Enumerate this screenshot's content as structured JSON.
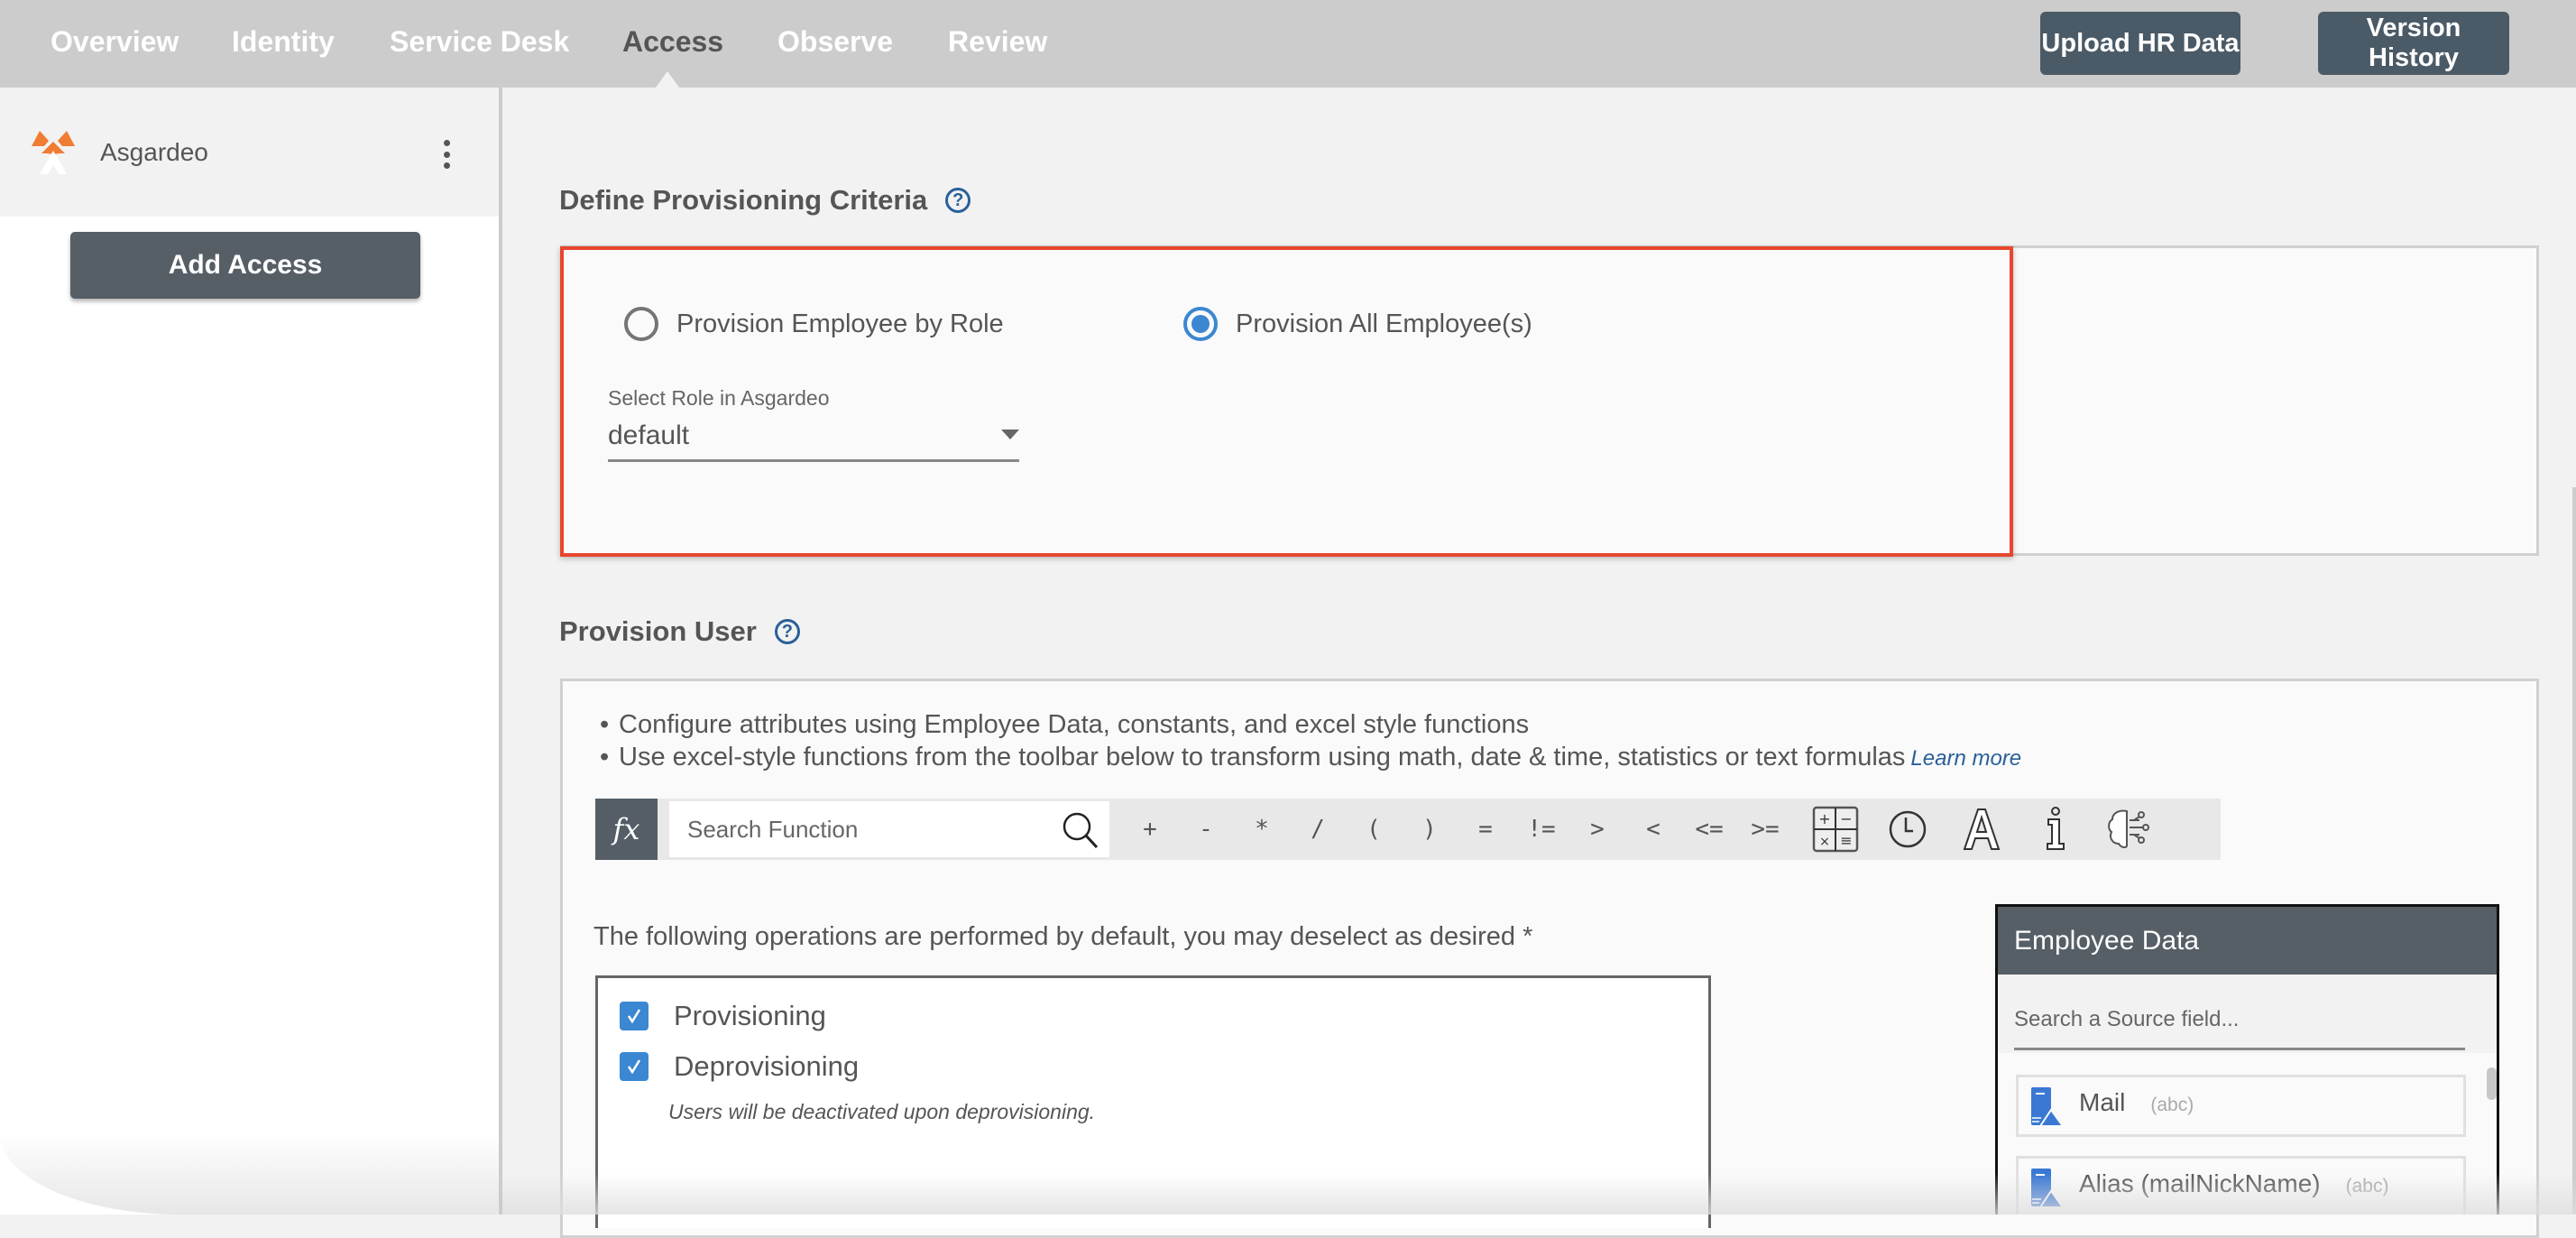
{
  "nav": {
    "tabs": [
      {
        "label": "Overview",
        "active": false
      },
      {
        "label": "Identity",
        "active": false
      },
      {
        "label": "Service Desk",
        "active": false
      },
      {
        "label": "Access",
        "active": true
      },
      {
        "label": "Observe",
        "active": false
      },
      {
        "label": "Review",
        "active": false
      }
    ],
    "upload_label": "Upload HR Data",
    "version_label": "Version History"
  },
  "sidebar": {
    "app_name": "Asgardeo",
    "app_logo": "asgardeo-logo",
    "menu_icon": "kebab-menu-icon",
    "add_access_label": "Add Access"
  },
  "criteria": {
    "title": "Define Provisioning Criteria",
    "help_glyph": "?",
    "options": [
      {
        "label": "Provision Employee by Role",
        "selected": false
      },
      {
        "label": "Provision All Employee(s)",
        "selected": true
      }
    ],
    "role_select": {
      "label": "Select Role in Asgardeo",
      "value": "default"
    },
    "highlight_color": "#e8462e"
  },
  "provision_user": {
    "title": "Provision User",
    "help_glyph": "?",
    "bullets": [
      "Configure attributes using Employee Data, constants, and excel style functions",
      "Use excel-style functions from the toolbar below to transform using math, date & time, statistics or text formulas"
    ],
    "learn_more": "Learn more",
    "toolbar": {
      "fx_label": "fx",
      "search_placeholder": "Search Function",
      "operators": [
        "+",
        "-",
        "*",
        "/",
        "(",
        ")",
        "=",
        "!=",
        ">",
        "<",
        "<=",
        ">="
      ],
      "tools": [
        "math-calculator-icon",
        "clock-icon",
        "text-icon",
        "info-icon",
        "ai-brain-icon"
      ]
    },
    "operations": {
      "label": "The following operations are performed by default, you may deselect as desired *",
      "items": [
        {
          "label": "Provisioning",
          "checked": true
        },
        {
          "label": "Deprovisioning",
          "checked": true
        }
      ],
      "note": "Users will be deactivated upon deprovisioning."
    },
    "employee_data": {
      "title": "Employee Data",
      "search_placeholder": "Search a Source field...",
      "fields": [
        {
          "name": "Mail",
          "type": "(abc)"
        },
        {
          "name": "Alias (mailNickName)",
          "type": "(abc)"
        }
      ]
    }
  },
  "colors": {
    "accent": "#3b87d1",
    "link": "#2a6099",
    "button": "#4a5a66",
    "logo": "#f07c32"
  }
}
